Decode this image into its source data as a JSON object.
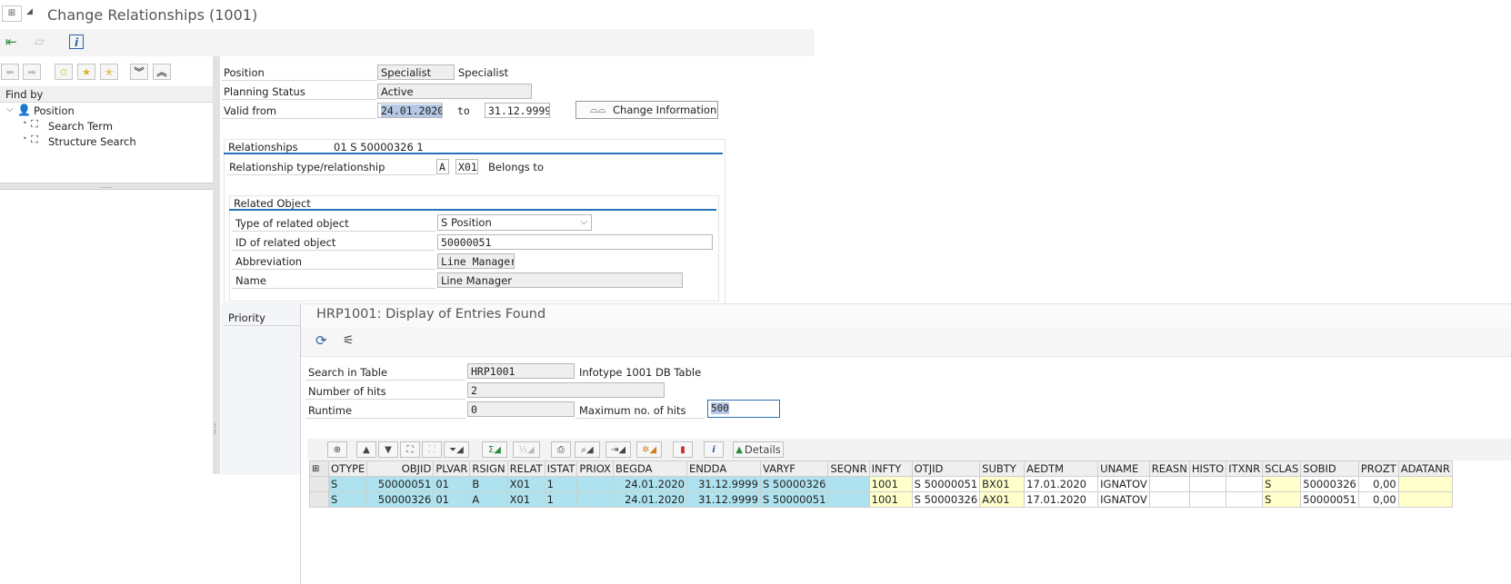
{
  "main_window": {
    "title": "Change Relationships (1001)"
  },
  "left_panel": {
    "find_by_label": "Find by",
    "tree_root": "Position",
    "tree_children": [
      "Search Term",
      "Structure Search"
    ]
  },
  "header_form": {
    "position_label": "Position",
    "position_value": "Specialist",
    "position_text": "Specialist",
    "planning_status_label": "Planning Status",
    "planning_status_value": "Active",
    "valid_from_label": "Valid from",
    "valid_from_value": "24.01.2020",
    "to_label": "to",
    "valid_to_value": "31.12.9999",
    "change_info_button": "Change Information"
  },
  "relationships": {
    "section_label": "Relationships",
    "section_value": "01 S  50000326 1",
    "rel_type_label": "Relationship type/relationship",
    "rel_type_a": "A",
    "rel_code": "X01",
    "rel_text": "Belongs to"
  },
  "related_object": {
    "section_label": "Related Object",
    "type_label": "Type of related object",
    "type_value": "S Position",
    "id_label": "ID of related object",
    "id_value": "50000051",
    "abbr_label": "Abbreviation",
    "abbr_value": "Line Manager",
    "name_label": "Name",
    "name_value": "Line Manager"
  },
  "priority_label": "Priority",
  "popup": {
    "title": "HRP1001: Display of Entries Found",
    "search_table_label": "Search in Table",
    "search_table_value": "HRP1001",
    "search_table_text": "Infotype 1001 DB Table",
    "hits_label": "Number of hits",
    "hits_value": "2",
    "runtime_label": "Runtime",
    "runtime_value": "0",
    "max_hits_label": "Maximum no. of hits",
    "max_hits_value": "500",
    "details_button": "Details"
  },
  "grid": {
    "columns": [
      "OTYPE",
      "OBJID",
      "PLVAR",
      "RSIGN",
      "RELAT",
      "ISTAT",
      "PRIOX",
      "BEGDA",
      "ENDDA",
      "VARYF",
      "SEQNR",
      "INFTY",
      "OTJID",
      "SUBTY",
      "AEDTM",
      "UNAME",
      "REASN",
      "HISTO",
      "ITXNR",
      "SCLAS",
      "SOBID",
      "PROZT",
      "ADATANR"
    ],
    "rows": [
      [
        "S",
        "50000051",
        "01",
        "B",
        "X01",
        "1",
        "",
        "24.01.2020",
        "31.12.9999",
        "S 50000326",
        "",
        "1001",
        "S 50000051",
        "BX01",
        "17.01.2020",
        "IGNATOV",
        "",
        "",
        "",
        "S",
        "50000326",
        "0,00",
        ""
      ],
      [
        "S",
        "50000326",
        "01",
        "A",
        "X01",
        "1",
        "",
        "24.01.2020",
        "31.12.9999",
        "S 50000051",
        "",
        "1001",
        "S 50000326",
        "AX01",
        "17.01.2020",
        "IGNATOV",
        "",
        "",
        "",
        "S",
        "50000051",
        "0,00",
        ""
      ]
    ]
  }
}
